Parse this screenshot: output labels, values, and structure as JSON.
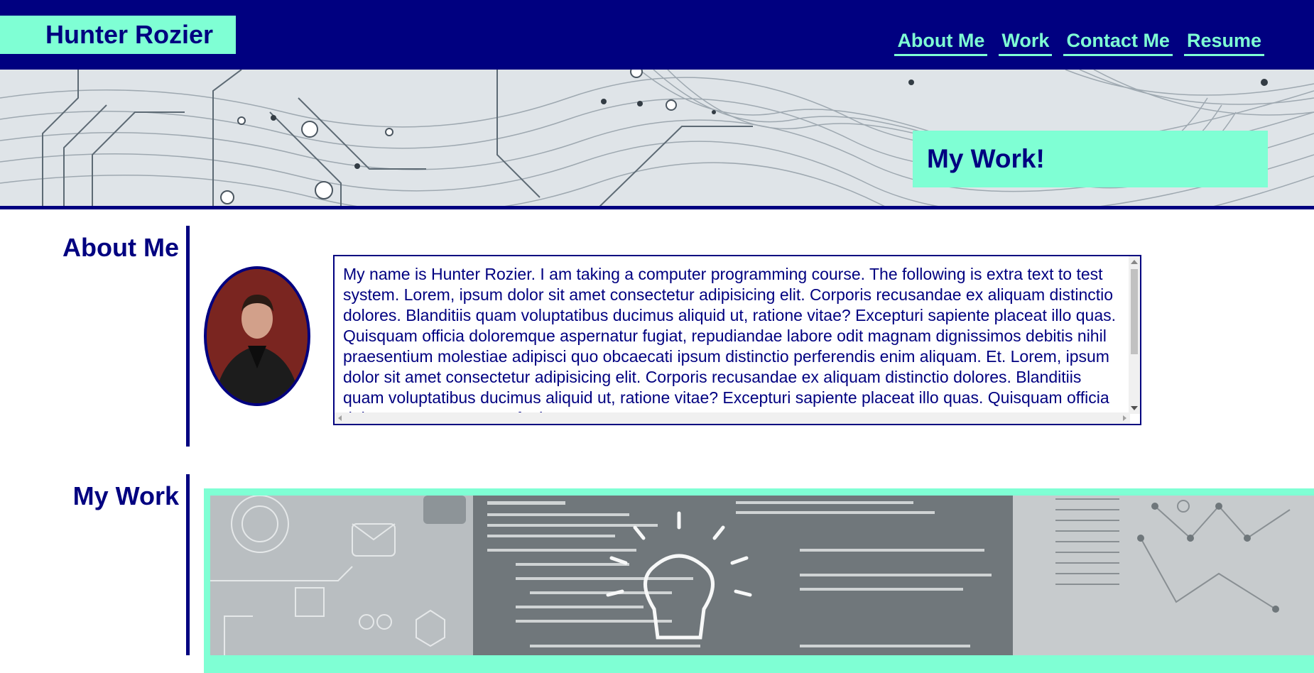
{
  "header": {
    "brand": "Hunter Rozier",
    "nav": [
      "About Me",
      "Work",
      "Contact Me",
      "Resume"
    ]
  },
  "hero": {
    "title": "My Work!"
  },
  "about": {
    "heading": "About Me",
    "text": "My name is Hunter Rozier. I am taking a computer programming course. The following is extra text to test system. Lorem, ipsum dolor sit amet consectetur adipisicing elit. Corporis recusandae ex aliquam distinctio dolores. Blanditiis quam voluptatibus ducimus aliquid ut, ratione vitae? Excepturi sapiente placeat illo quas. Quisquam officia doloremque aspernatur fugiat, repudiandae labore odit magnam dignissimos debitis nihil praesentium molestiae adipisci quo obcaecati ipsum distinctio perferendis enim aliquam. Et. Lorem, ipsum dolor sit amet consectetur adipisicing elit. Corporis recusandae ex aliquam distinctio dolores. Blanditiis quam voluptatibus ducimus aliquid ut, ratione vitae? Excepturi sapiente placeat illo quas. Quisquam officia doloremque aspernatur fugiat."
  },
  "work": {
    "heading": "My Work"
  },
  "colors": {
    "navy": "#000080",
    "aquamarine": "#7fffd4"
  }
}
